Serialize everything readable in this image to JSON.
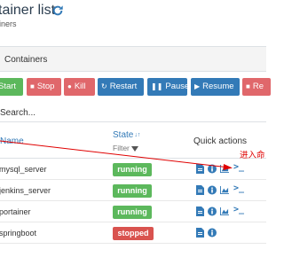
{
  "header": {
    "title": "tainer list",
    "breadcrumb": "iners"
  },
  "panel": {
    "title": "Containers"
  },
  "toolbar": {
    "start_label": "Start",
    "stop_label": "Stop",
    "kill_label": "Kill",
    "restart_label": "Restart",
    "pause_label": "Pause",
    "resume_label": "Resume",
    "remove_label": "Re"
  },
  "search": {
    "placeholder": "Search..."
  },
  "table": {
    "columns": {
      "name": "Name",
      "state": "State",
      "filter": "Filter",
      "quick_actions": "Quick actions"
    },
    "rows": [
      {
        "name": "mysql_server",
        "state": "running",
        "console_glyph": ">_"
      },
      {
        "name": "jenkins_server",
        "state": "running",
        "console_glyph": ">_"
      },
      {
        "name": "portainer",
        "state": "running",
        "console_glyph": ">_"
      },
      {
        "name": "springboot",
        "state": "stopped",
        "console_glyph": ""
      }
    ]
  },
  "annotation": {
    "text": "进入命"
  },
  "colors": {
    "primary": "#337ab7",
    "success": "#5cb85c",
    "danger": "#e0676b",
    "stopped": "#d9534f",
    "annotation": "#e00000"
  }
}
